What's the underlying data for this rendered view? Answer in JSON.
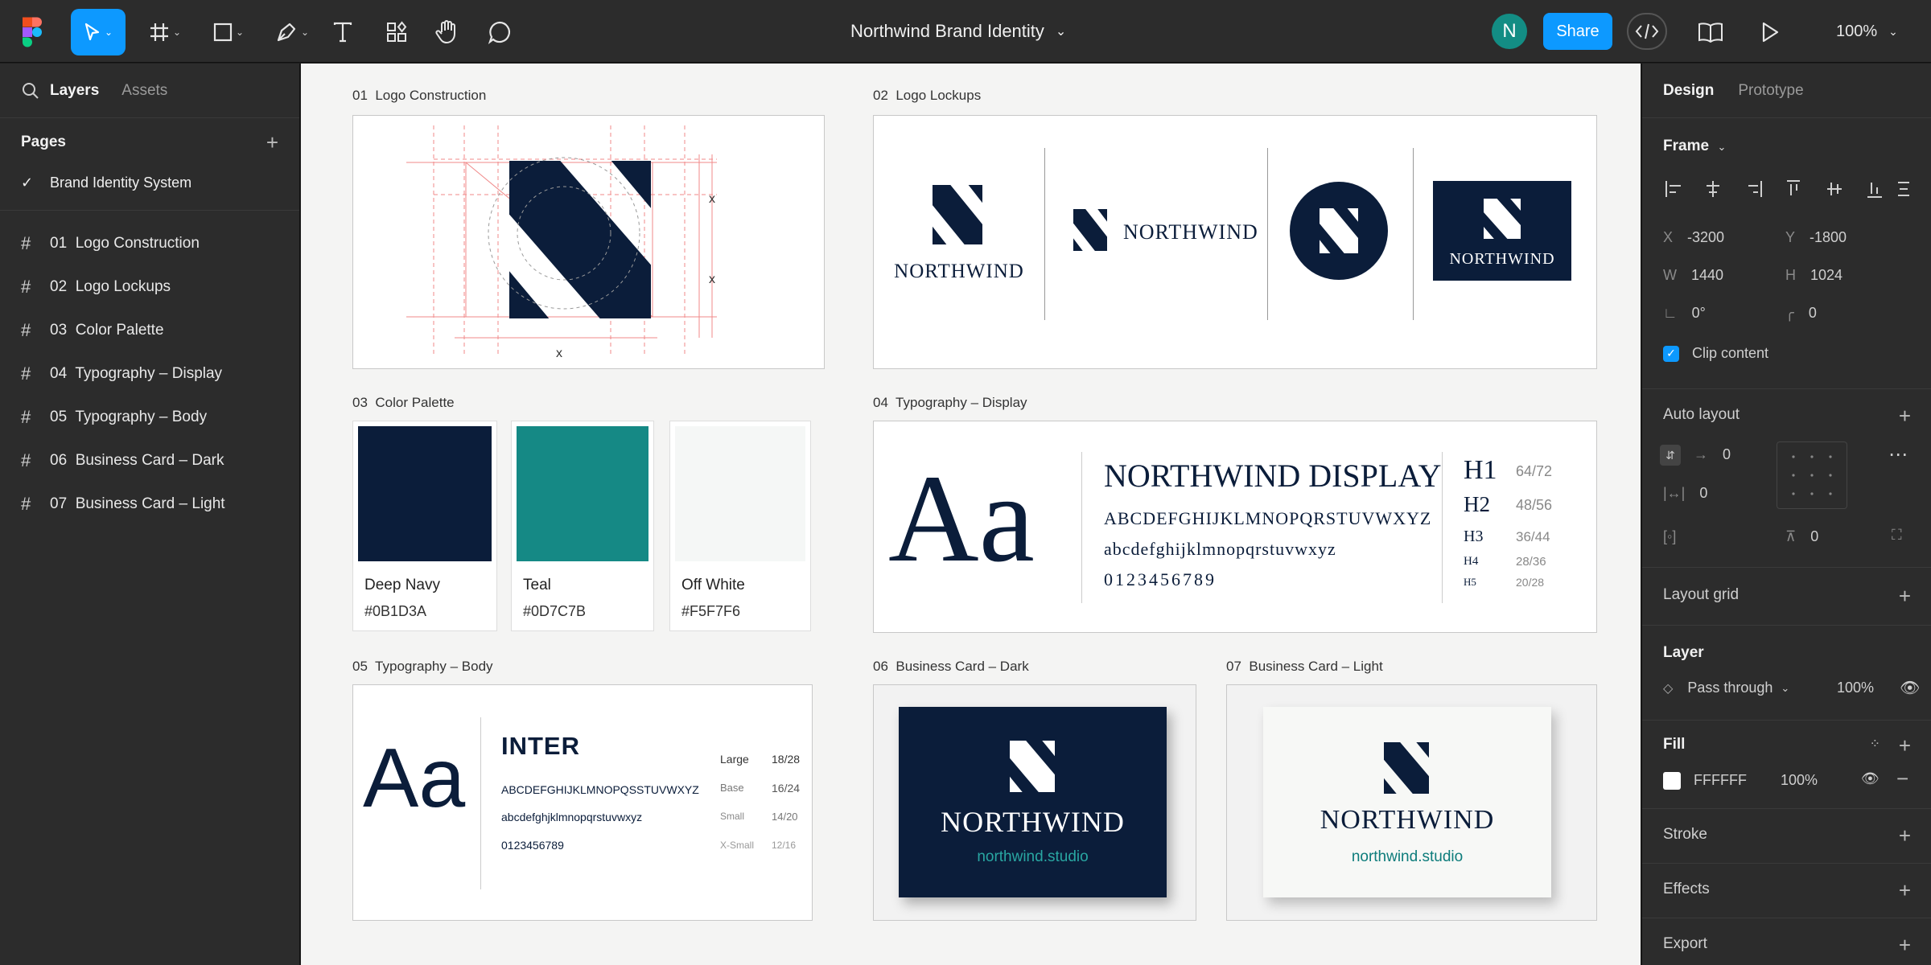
{
  "toolbar": {
    "doc_title": "Northwind Brand Identity",
    "share_label": "Share",
    "zoom": "100%",
    "avatar_initial": "N",
    "accent": "#0d99ff"
  },
  "left_panel": {
    "tabs": [
      "Layers",
      "Assets"
    ],
    "pages_heading": "Pages",
    "current_page": "Brand Identity System",
    "frames": [
      "01  Logo Construction",
      "02  Logo Lockups",
      "03  Color Palette",
      "04  Typography – Display",
      "05  Typography – Body",
      "06  Business Card – Dark",
      "07  Business Card – Light"
    ]
  },
  "canvas": {
    "frame_labels": {
      "f1": "01  Logo Construction",
      "f2": "02  Logo Lockups",
      "f3": "03  Color Palette",
      "f4": "04  Typography – Display",
      "f5": "05  Typography – Body",
      "f6": "06  Business Card – Dark",
      "f7": "07  Business Card – Light"
    },
    "construction_marks": [
      "x",
      "x",
      "x"
    ],
    "brand_name": "NORTHWIND",
    "palette": [
      {
        "name": "Deep Navy",
        "hex": "#0B1D3A"
      },
      {
        "name": "Teal",
        "hex": "#0D7C7B"
      },
      {
        "name": "Off White",
        "hex": "#F5F7F6"
      }
    ],
    "display": {
      "specimen": "Aa",
      "title": "NORTHWIND DISPLAY",
      "upper": "ABCDEFGHIJKLMNOPQRSTUVWXYZ",
      "lower": "abcdefghijklmnopqrstuvwxyz",
      "digits": "0123456789",
      "scale": [
        {
          "tag": "H1",
          "size": "64/72"
        },
        {
          "tag": "H2",
          "size": "48/56"
        },
        {
          "tag": "H3",
          "size": "36/44"
        },
        {
          "tag": "H4",
          "size": "28/36"
        },
        {
          "tag": "H5",
          "size": "20/28"
        }
      ]
    },
    "body": {
      "specimen": "Aa",
      "title": "INTER",
      "upper": "ABCDEFGHIJKLMNOPQSSTUVWXYZ",
      "lower": "abcdefghjklmnopqrstuvwxyz",
      "digits": "0123456789",
      "scale": [
        {
          "tag": "Large",
          "size": "18/28"
        },
        {
          "tag": "Base",
          "size": "16/24"
        },
        {
          "tag": "Small",
          "size": "14/20"
        },
        {
          "tag": "X-Small",
          "size": "12/16"
        }
      ]
    },
    "card_url": "northwind.studio"
  },
  "right_panel": {
    "tabs": [
      "Design",
      "Prototype"
    ],
    "frame_label": "Frame",
    "x_label": "X",
    "x": "-3200",
    "y_label": "Y",
    "y": "-1800",
    "w_label": "W",
    "w": "1440",
    "h_label": "H",
    "h": "1024",
    "rotation": "0°",
    "radius": "0",
    "clip_content": "Clip content",
    "auto_layout": "Auto layout",
    "al_gap": "0",
    "al_pad_h": "0",
    "al_pad_v": "0",
    "layout_grid": "Layout grid",
    "layer": "Layer",
    "blend": "Pass through",
    "layer_opacity": "100%",
    "fill": "Fill",
    "fill_hex": "FFFFFF",
    "fill_opacity": "100%",
    "stroke": "Stroke",
    "effects": "Effects",
    "export": "Export"
  }
}
